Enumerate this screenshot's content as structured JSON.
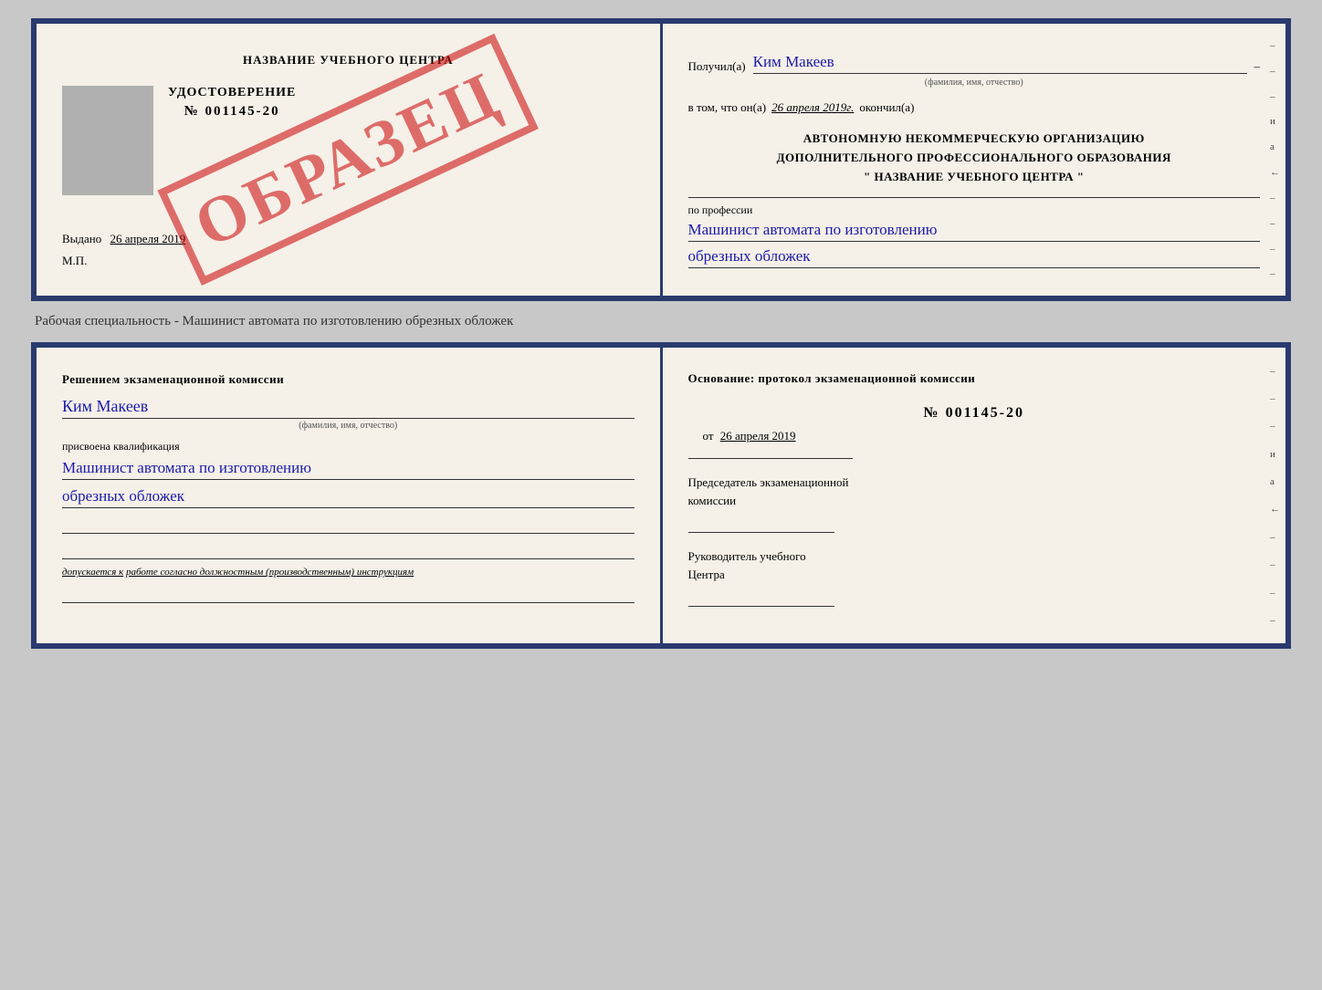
{
  "topCard": {
    "left": {
      "centerTitle": "НАЗВАНИЕ УЧЕБНОГО ЦЕНТРА",
      "watermark": "ОБРАЗЕЦ",
      "certTitle": "УДОСТОВЕРЕНИЕ",
      "certNumber": "№ 001145-20",
      "issuedLabel": "Выдано",
      "issuedDate": "26 апреля 2019",
      "mpLabel": "М.П."
    },
    "right": {
      "recipientLabel": "Получил(а)",
      "recipientName": "Ким Макеев",
      "recipientDash": "–",
      "nameHint": "(фамилия, имя, отчество)",
      "completionLabel": "в том, что он(а)",
      "completionDate": "26 апреля 2019г.",
      "completionSuffix": "окончил(а)",
      "orgLine1": "АВТОНОМНУЮ НЕКОММЕРЧЕСКУЮ ОРГАНИЗАЦИЮ",
      "orgLine2": "ДОПОЛНИТЕЛЬНОГО ПРОФЕССИОНАЛЬНОГО ОБРАЗОВАНИЯ",
      "orgLine3": "\"   НАЗВАНИЕ УЧЕБНОГО ЦЕНТРА   \"",
      "professionLabel": "по профессии",
      "professionLine1": "Машинист автомата по изготовлению",
      "professionLine2": "обрезных обложек",
      "sideMarks": [
        "–",
        "–",
        "–",
        "и",
        "а",
        "←",
        "–",
        "–",
        "–",
        "–"
      ]
    }
  },
  "specialtyText": "Рабочая специальность - Машинист автомата по изготовлению обрезных обложек",
  "bottomCard": {
    "left": {
      "titleLine1": "Решением экзаменационной комиссии",
      "personName": "Ким Макеев",
      "nameHint": "(фамилия, имя, отчество)",
      "assignedLabel": "присвоена квалификация",
      "qualLine1": "Машинист автомата по изготовлению",
      "qualLine2": "обрезных обложек",
      "allowedPrefix": "допускается к",
      "allowedText": "работе согласно должностным (производственным) инструкциям"
    },
    "right": {
      "basisLabel": "Основание: протокол экзаменационной комиссии",
      "protocolNumber": "№ 001145-20",
      "protocolDatePrefix": "от",
      "protocolDate": "26 апреля 2019",
      "commissionHeadLabel": "Председатель экзаменационной",
      "commissionHeadLabel2": "комиссии",
      "centerHeadLabel": "Руководитель учебного",
      "centerHeadLabel2": "Центра",
      "sideMarks": [
        "–",
        "–",
        "–",
        "и",
        "а",
        "←",
        "–",
        "–",
        "–",
        "–"
      ]
    }
  }
}
